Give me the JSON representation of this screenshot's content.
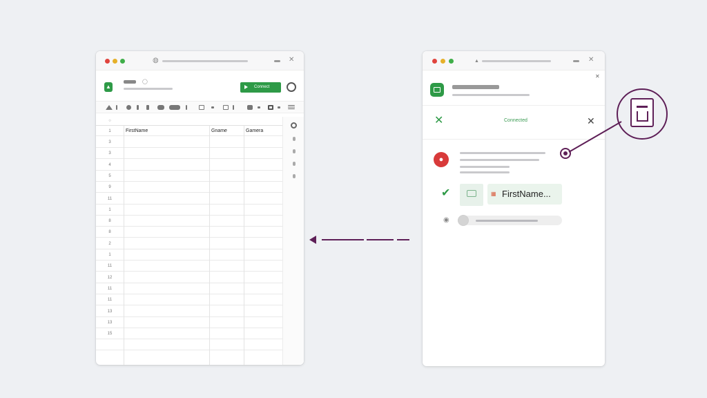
{
  "spreadsheet_window": {
    "toolbar": {
      "action_label": "Connect"
    },
    "columns": [
      "",
      "",
      ""
    ],
    "header_row": {
      "row_number": "1",
      "cells": [
        "FirstName",
        "Gname",
        "Gamera"
      ]
    },
    "row_numbers": [
      "3",
      "3",
      "4",
      "5",
      "9",
      "11",
      "1",
      "8",
      "8",
      "2",
      "1",
      "11",
      "12",
      "11",
      "11",
      "13",
      "13",
      "15",
      ""
    ]
  },
  "extension_window": {
    "status_text": "Connected",
    "field_chip": {
      "label": "FirstName..."
    }
  },
  "colors": {
    "accent_green": "#2e9a47",
    "connector_purple": "#5e1f57",
    "alert_red": "#d83a3a"
  },
  "icons": [
    "lock-icon",
    "close-icon",
    "check-icon",
    "key-icon",
    "document-icon",
    "arrow-left-icon"
  ]
}
